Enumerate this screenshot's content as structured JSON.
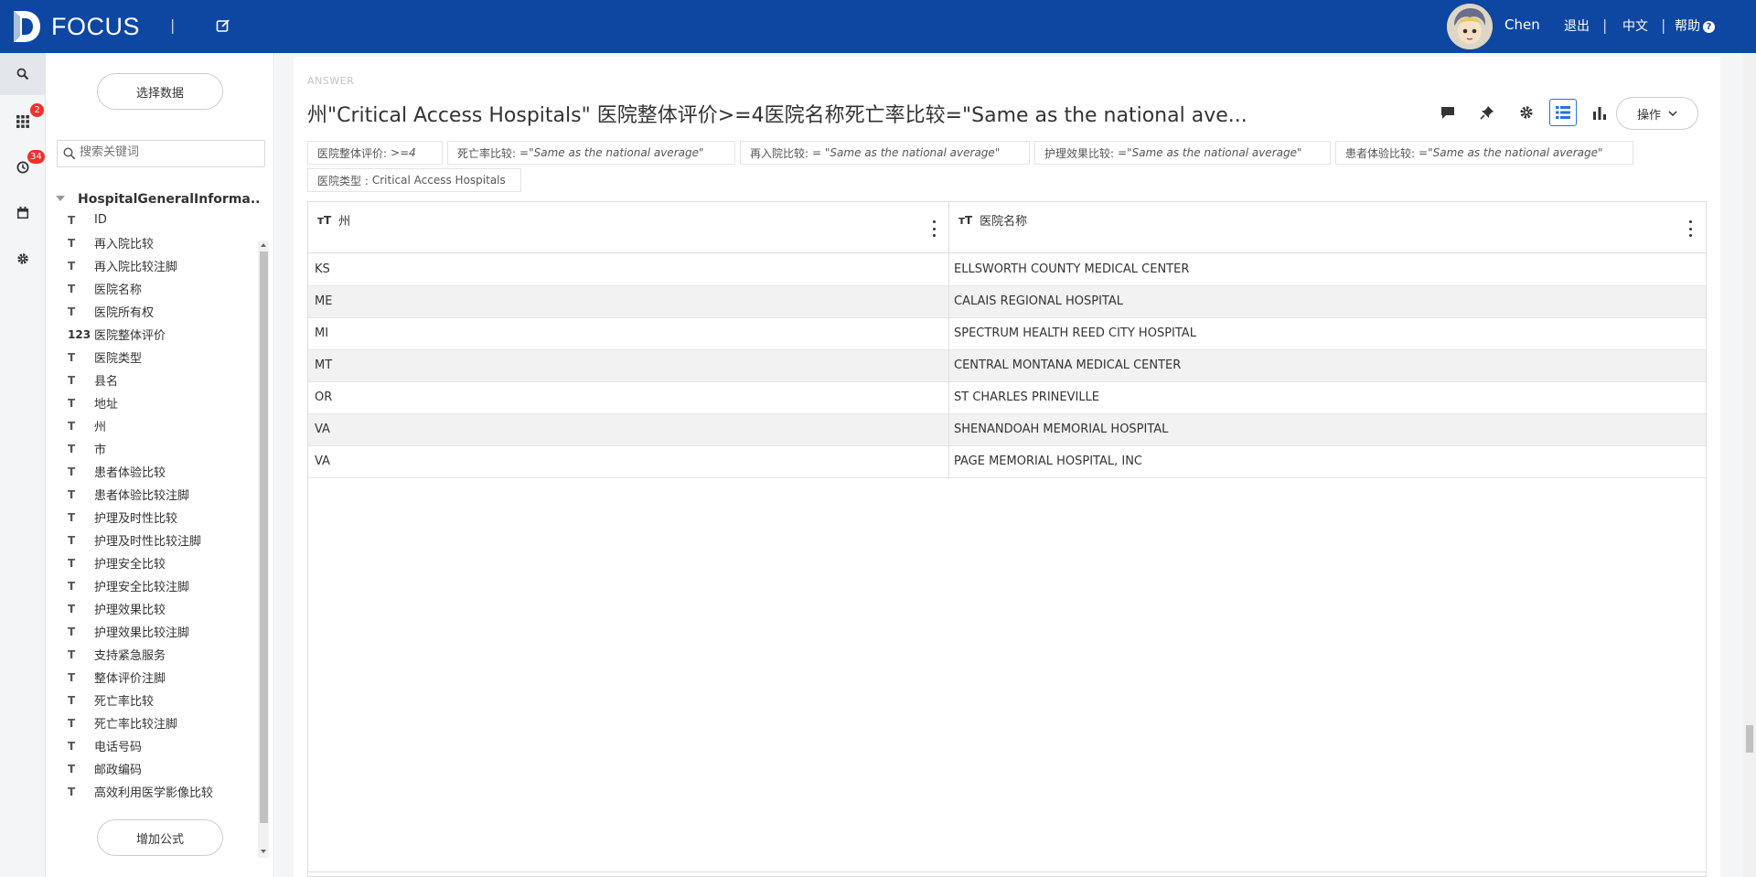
{
  "header": {
    "logo_text": "FOCUS",
    "separator": "|",
    "user_name": "Chen",
    "links": {
      "logout": "退出",
      "language": "中文",
      "help": "帮助"
    },
    "help_icon_glyph": "?",
    "bg_color": "#0d47a1"
  },
  "rail": {
    "items": [
      {
        "icon": "search-icon"
      },
      {
        "icon": "apps-grid-icon",
        "badge": "2"
      },
      {
        "icon": "history-clock-icon",
        "badge": "34"
      },
      {
        "icon": "calendar-icon"
      },
      {
        "icon": "settings-gear-icon"
      }
    ],
    "badge_color": "#f0302b"
  },
  "data_panel": {
    "select_data_label": "选择数据",
    "search_placeholder": "搜索关键词",
    "table_name": "HospitalGeneralInforma...",
    "fields": [
      {
        "type": "T",
        "name": "ID"
      },
      {
        "type": "T",
        "name": "再入院比较"
      },
      {
        "type": "T",
        "name": "再入院比较注脚"
      },
      {
        "type": "T",
        "name": "医院名称"
      },
      {
        "type": "T",
        "name": "医院所有权"
      },
      {
        "type": "123",
        "name": "医院整体评价"
      },
      {
        "type": "T",
        "name": "医院类型"
      },
      {
        "type": "T",
        "name": "县名"
      },
      {
        "type": "T",
        "name": "地址"
      },
      {
        "type": "T",
        "name": "州"
      },
      {
        "type": "T",
        "name": "市"
      },
      {
        "type": "T",
        "name": "患者体验比较"
      },
      {
        "type": "T",
        "name": "患者体验比较注脚"
      },
      {
        "type": "T",
        "name": "护理及时性比较"
      },
      {
        "type": "T",
        "name": "护理及时性比较注脚"
      },
      {
        "type": "T",
        "name": "护理安全比较"
      },
      {
        "type": "T",
        "name": "护理安全比较注脚"
      },
      {
        "type": "T",
        "name": "护理效果比较"
      },
      {
        "type": "T",
        "name": "护理效果比较注脚"
      },
      {
        "type": "T",
        "name": "支持紧急服务"
      },
      {
        "type": "T",
        "name": "整体评价注脚"
      },
      {
        "type": "T",
        "name": "死亡率比较"
      },
      {
        "type": "T",
        "name": "死亡率比较注脚"
      },
      {
        "type": "T",
        "name": "电话号码"
      },
      {
        "type": "T",
        "name": "邮政编码"
      },
      {
        "type": "T",
        "name": "高效利用医学影像比较"
      }
    ],
    "add_formula_label": "增加公式"
  },
  "main": {
    "answer_label": "ANSWER",
    "title": "州\"Critical Access Hospitals\" 医院整体评价>=4医院名称死亡率比较=\"Same as the national ave...",
    "toolbar": {
      "operations_label": "操作",
      "icons": [
        "comment-icon",
        "pin-icon",
        "settings-gear-icon",
        "table-view-icon",
        "bar-chart-icon"
      ],
      "active_color": "#2f6fd8"
    },
    "filters": [
      {
        "label": "医院整体评价:",
        "value": ">=4"
      },
      {
        "label": "死亡率比较:",
        "value": "=\"Same as the national average\""
      },
      {
        "label": "再入院比较:",
        "value": "= \"Same as the national average\""
      },
      {
        "label": "护理效果比较:",
        "value": "=\"Same as the national average\""
      },
      {
        "label": "患者体验比较:",
        "value": "=\"Same as the national average\""
      },
      {
        "label": "医院类型 :",
        "value": "Critical Access Hospitals"
      }
    ],
    "table": {
      "columns": [
        {
          "label": "州"
        },
        {
          "label": "医院名称"
        }
      ],
      "rows": [
        [
          "KS",
          "ELLSWORTH COUNTY MEDICAL CENTER"
        ],
        [
          "ME",
          "CALAIS REGIONAL HOSPITAL"
        ],
        [
          "MI",
          "SPECTRUM HEALTH REED CITY HOSPITAL"
        ],
        [
          "MT",
          "CENTRAL MONTANA MEDICAL CENTER"
        ],
        [
          "OR",
          "ST CHARLES PRINEVILLE"
        ],
        [
          "VA",
          "SHENANDOAH MEMORIAL HOSPITAL"
        ],
        [
          "VA",
          "PAGE MEMORIAL HOSPITAL, INC"
        ]
      ]
    }
  }
}
